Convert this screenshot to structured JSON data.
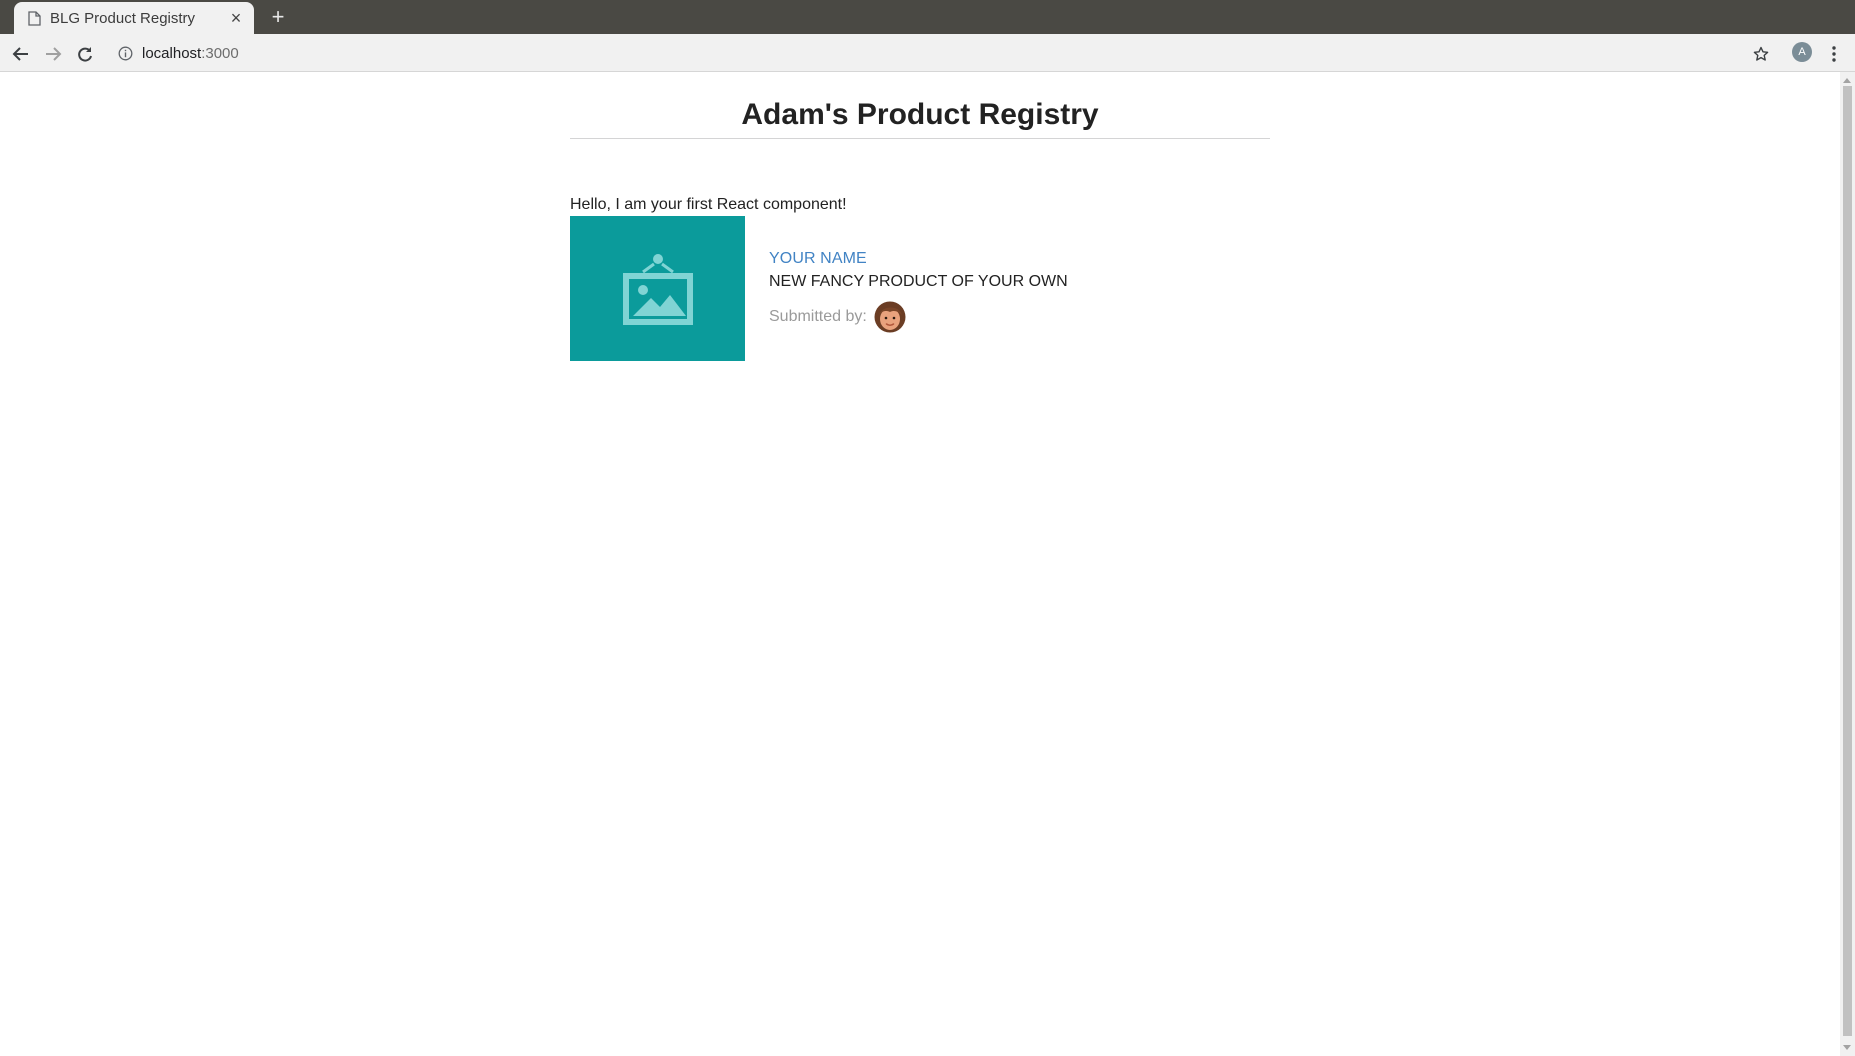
{
  "browser": {
    "tab": {
      "title": "BLG Product Registry",
      "close_glyph": "×"
    },
    "new_tab_glyph": "+",
    "url": {
      "host": "localhost",
      "port": ":3000"
    },
    "profile_initial": "A",
    "icons": {
      "back": "back-arrow-icon",
      "forward": "forward-arrow-icon",
      "reload": "reload-icon",
      "info": "info-icon",
      "bookmark": "star-icon",
      "menu": "kebab-menu-icon"
    }
  },
  "page": {
    "title": "Adam's Product Registry",
    "greeting": "Hello, I am your first React component!",
    "product": {
      "header": "YOUR NAME",
      "description": "NEW FANCY PRODUCT OF YOUR OWN",
      "submitted_label": "Submitted by:",
      "image_icon": "image-placeholder-icon",
      "avatar_icon": "submitter-avatar-icon"
    }
  },
  "colors": {
    "product_image_bg": "#0b9b9b",
    "header_link": "#4183c4",
    "submitted_label": "#9a9a9a",
    "tabstrip": "#4a4944"
  }
}
